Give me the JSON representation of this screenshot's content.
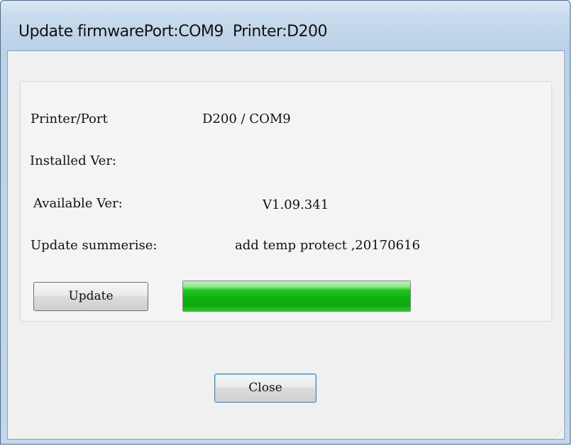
{
  "window": {
    "title": "Update firmwarePort:COM9  Printer:D200"
  },
  "fields": {
    "printer_port_label": "Printer/Port",
    "printer_port_value": "D200 / COM9",
    "installed_ver_label": "Installed Ver:",
    "installed_ver_value": "",
    "available_ver_label": "Available Ver:",
    "available_ver_value": "V1.09.341",
    "update_summary_label": "Update summerise:",
    "update_summary_value": "add temp protect ,20170616"
  },
  "buttons": {
    "update_label": "Update",
    "close_label": "Close"
  },
  "progress": {
    "fraction": 1.0
  },
  "colors": {
    "progress_fill": "#0fb20f",
    "title_bar": "#c9dcee"
  }
}
